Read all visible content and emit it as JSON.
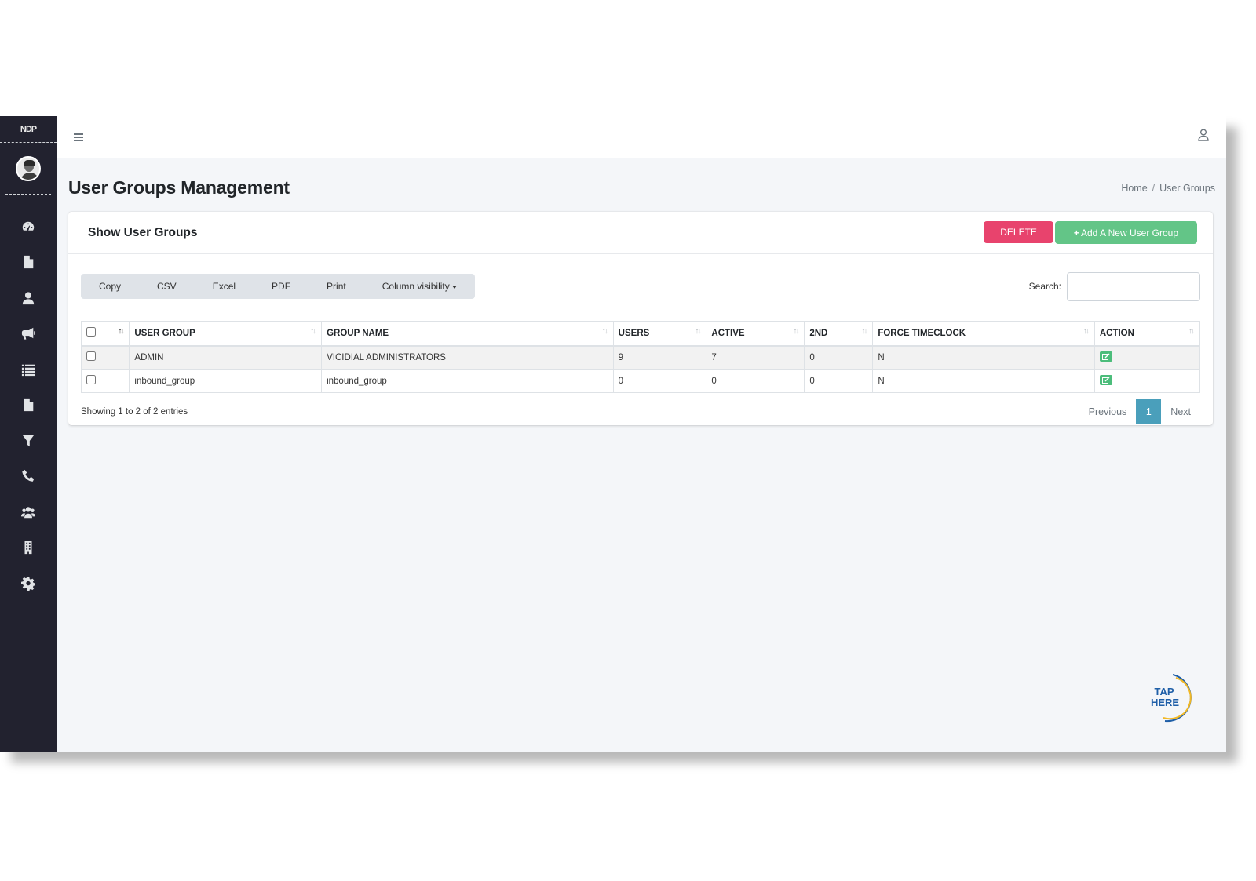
{
  "sidebar": {
    "logo_text": "NDP",
    "items": [
      {
        "icon": "dashboard-icon"
      },
      {
        "icon": "file-icon"
      },
      {
        "icon": "user-icon"
      },
      {
        "icon": "megaphone-icon"
      },
      {
        "icon": "list-icon"
      },
      {
        "icon": "document-icon"
      },
      {
        "icon": "filter-icon"
      },
      {
        "icon": "phone-icon"
      },
      {
        "icon": "users-icon"
      },
      {
        "icon": "building-icon"
      },
      {
        "icon": "gear-icon"
      }
    ]
  },
  "header": {
    "page_title": "User Groups Management",
    "breadcrumb": {
      "home": "Home",
      "separator": "/",
      "current": "User Groups"
    }
  },
  "card": {
    "title": "Show User Groups",
    "delete_label": "DELETE",
    "add_label": "Add A New User Group",
    "add_icon": "+"
  },
  "toolbar": {
    "buttons": [
      "Copy",
      "CSV",
      "Excel",
      "PDF",
      "Print",
      "Column visibility"
    ],
    "search_label": "Search:",
    "search_value": ""
  },
  "table": {
    "columns": [
      "USER GROUP",
      "GROUP NAME",
      "USERS",
      "ACTIVE",
      "2ND",
      "FORCE TIMECLOCK",
      "ACTION"
    ],
    "rows": [
      {
        "user_group": "ADMIN",
        "group_name": "VICIDIAL ADMINISTRATORS",
        "users": "9",
        "active": "7",
        "second": "0",
        "force_timeclock": "N"
      },
      {
        "user_group": "inbound_group",
        "group_name": "inbound_group",
        "users": "0",
        "active": "0",
        "second": "0",
        "force_timeclock": "N"
      }
    ]
  },
  "footer": {
    "info": "Showing 1 to 2 of 2 entries",
    "previous": "Previous",
    "current_page": "1",
    "next": "Next"
  },
  "tap_here": {
    "line1": "TAP",
    "line2": "HERE"
  },
  "colors": {
    "sidebar_bg": "#22222f",
    "delete": "#e8436d",
    "add": "#63c587",
    "pagination_active": "#4a9fbb"
  }
}
